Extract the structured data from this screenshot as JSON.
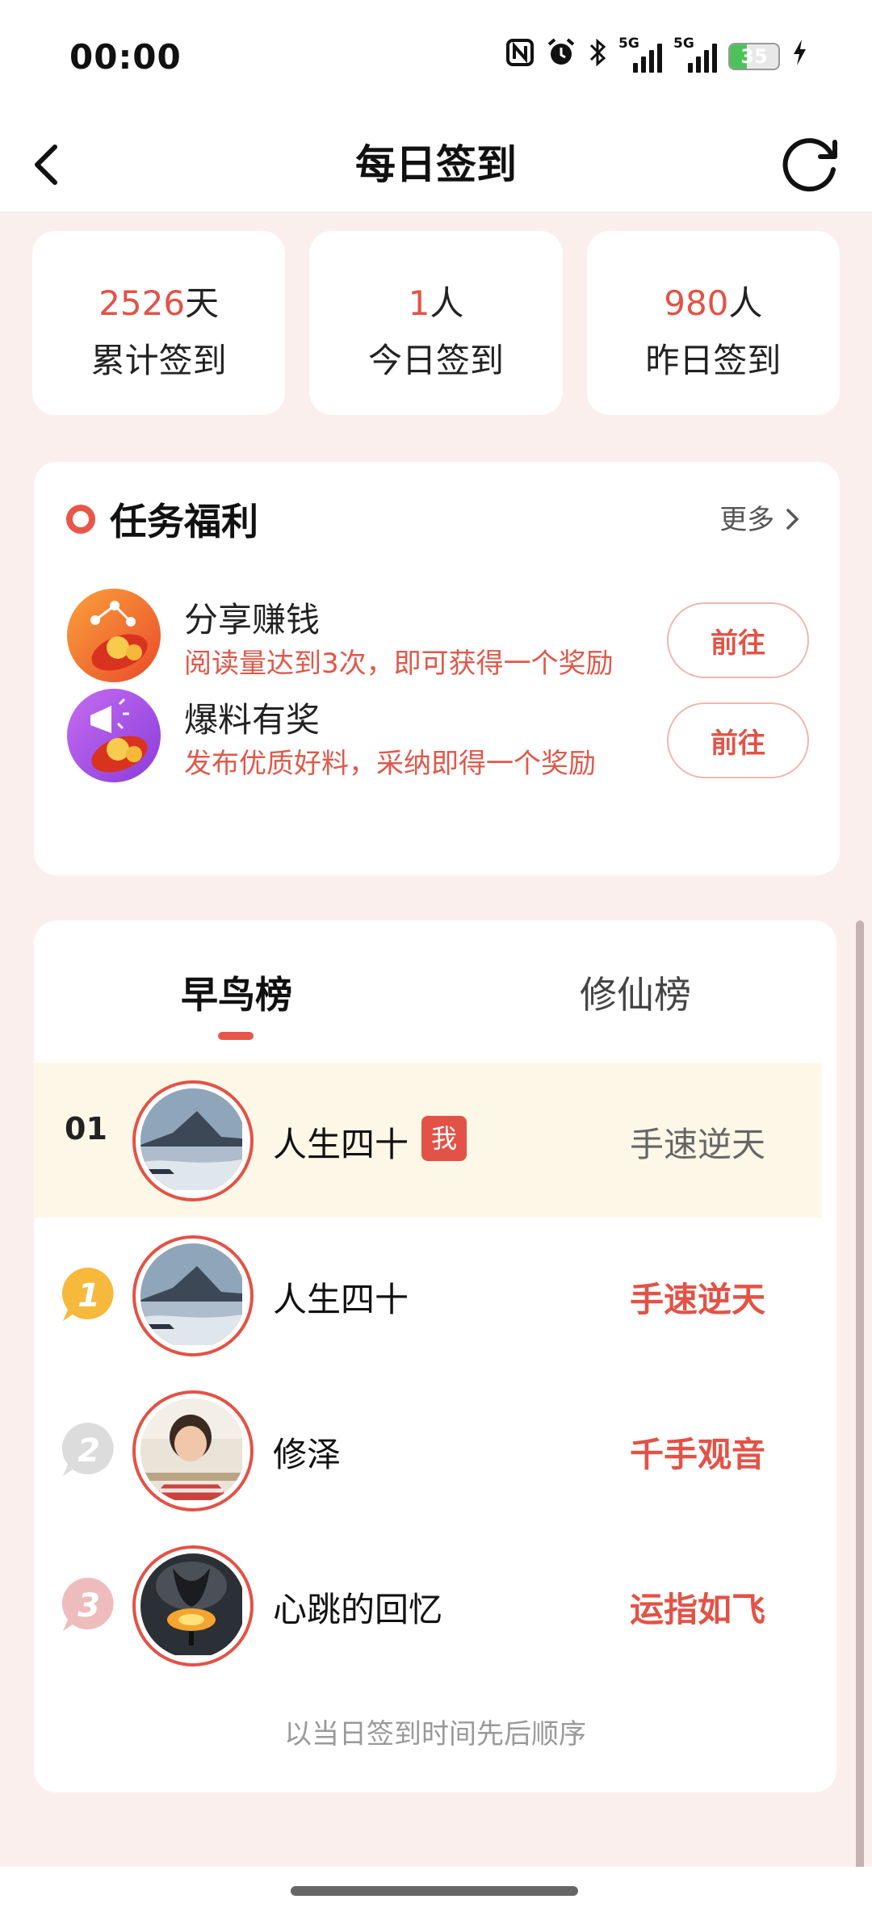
{
  "status_bar": {
    "time": "00:00",
    "signal1_tag": "5G",
    "signal2_tag": "5G",
    "battery": "35",
    "battery_level": 0.35
  },
  "header": {
    "title": "每日签到"
  },
  "stats": [
    {
      "value": "2526",
      "unit": "天",
      "label": "累计签到"
    },
    {
      "value": "1",
      "unit": "人",
      "label": "今日签到"
    },
    {
      "value": "980",
      "unit": "人",
      "label": "昨日签到"
    }
  ],
  "tasks": {
    "title": "任务福利",
    "more": "更多",
    "items": [
      {
        "name": "分享赚钱",
        "desc": "阅读量达到3次，即可获得一个奖励",
        "button": "前往"
      },
      {
        "name": "爆料有奖",
        "desc": "发布优质好料，采纳即得一个奖励",
        "button": "前往"
      }
    ]
  },
  "ranking": {
    "tabs": [
      "早鸟榜",
      "修仙榜"
    ],
    "me": {
      "position": "01",
      "name": "人生四十",
      "badge": "我",
      "title": "手速逆天"
    },
    "rows": [
      {
        "rank": "1",
        "name": "人生四十",
        "title": "手速逆天"
      },
      {
        "rank": "2",
        "name": "修泽",
        "title": "千手观音"
      },
      {
        "rank": "3",
        "name": "心跳的回忆",
        "title": "运指如飞"
      }
    ],
    "footnote": "以当日签到时间先后顺序"
  },
  "colors": {
    "accent": "#e35246",
    "background": "#fbefee",
    "me_row": "#fdf7e7"
  }
}
